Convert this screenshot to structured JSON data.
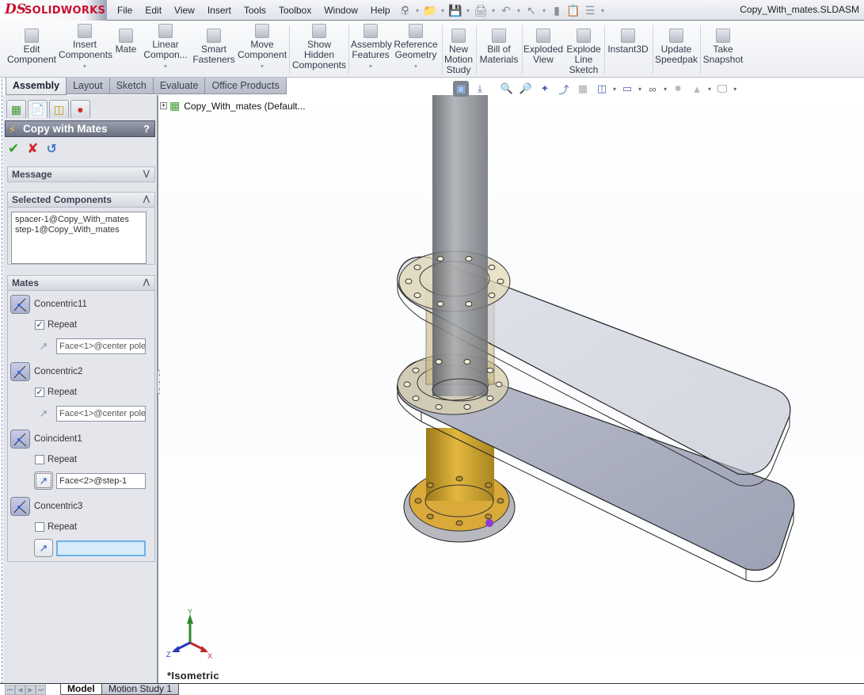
{
  "app": {
    "logo_ds": "DS",
    "logo_text": "SOLIDWORKS",
    "document_title": "Copy_With_mates.SLDASM",
    "brand_color": "#c8102e"
  },
  "menu": {
    "items": [
      "File",
      "Edit",
      "View",
      "Insert",
      "Tools",
      "Toolbox",
      "Window",
      "Help"
    ]
  },
  "command_manager": {
    "buttons": [
      {
        "label": "Edit\nComponent",
        "icon": "edit-component-icon"
      },
      {
        "label": "Insert\nComponents",
        "icon": "insert-components-icon",
        "dropdown": true
      },
      {
        "label": "Mate",
        "icon": "mate-paperclip-icon"
      },
      {
        "label": "Linear\nCompon...",
        "icon": "linear-pattern-icon",
        "dropdown": true
      },
      {
        "label": "Smart\nFasteners",
        "icon": "smart-fasteners-icon"
      },
      {
        "label": "Move\nComponent",
        "icon": "move-component-icon",
        "dropdown": true
      },
      {
        "label": "Show\nHidden\nComponents",
        "icon": "show-hidden-icon"
      },
      {
        "label": "Assembly\nFeatures",
        "icon": "assembly-features-icon",
        "dropdown": true
      },
      {
        "label": "Reference\nGeometry",
        "icon": "reference-geometry-icon",
        "dropdown": true
      },
      {
        "label": "New\nMotion\nStudy",
        "icon": "motion-study-icon"
      },
      {
        "label": "Bill of\nMaterials",
        "icon": "bom-icon"
      },
      {
        "label": "Exploded\nView",
        "icon": "exploded-view-icon"
      },
      {
        "label": "Explode\nLine\nSketch",
        "icon": "explode-line-icon"
      },
      {
        "label": "Instant3D",
        "icon": "instant3d-icon"
      },
      {
        "label": "Update\nSpeedpak",
        "icon": "speedpak-icon"
      },
      {
        "label": "Take\nSnapshot",
        "icon": "snapshot-icon"
      }
    ],
    "tabs": [
      "Assembly",
      "Layout",
      "Sketch",
      "Evaluate",
      "Office Products"
    ],
    "active_tab": "Assembly"
  },
  "feature_tree": {
    "root_label": "Copy_With_mates  (Default..."
  },
  "property_manager": {
    "title": "Copy with Mates",
    "help": "?",
    "message_group": "Message",
    "selected_group": "Selected Components",
    "selected_components": [
      "spacer-1@Copy_With_mates",
      "step-1@Copy_With_mates"
    ],
    "mates_group": "Mates",
    "repeat_label": "Repeat",
    "mates": [
      {
        "name": "Concentric11",
        "repeat": true,
        "value": "Face<1>@center pole",
        "state": "disabled"
      },
      {
        "name": "Concentric2",
        "repeat": true,
        "value": "Face<1>@center pole",
        "state": "disabled"
      },
      {
        "name": "Coincident1",
        "repeat": false,
        "value": "Face<2>@step-1",
        "state": "active"
      },
      {
        "name": "Concentric3",
        "repeat": false,
        "value": "",
        "state": "focused-empty"
      }
    ]
  },
  "viewport": {
    "view_name": "*Isometric",
    "triad": {
      "x": "X",
      "y": "Y",
      "z": "Z"
    }
  },
  "bottom_tabs": {
    "model": "Model",
    "motion": "Motion Study 1"
  }
}
